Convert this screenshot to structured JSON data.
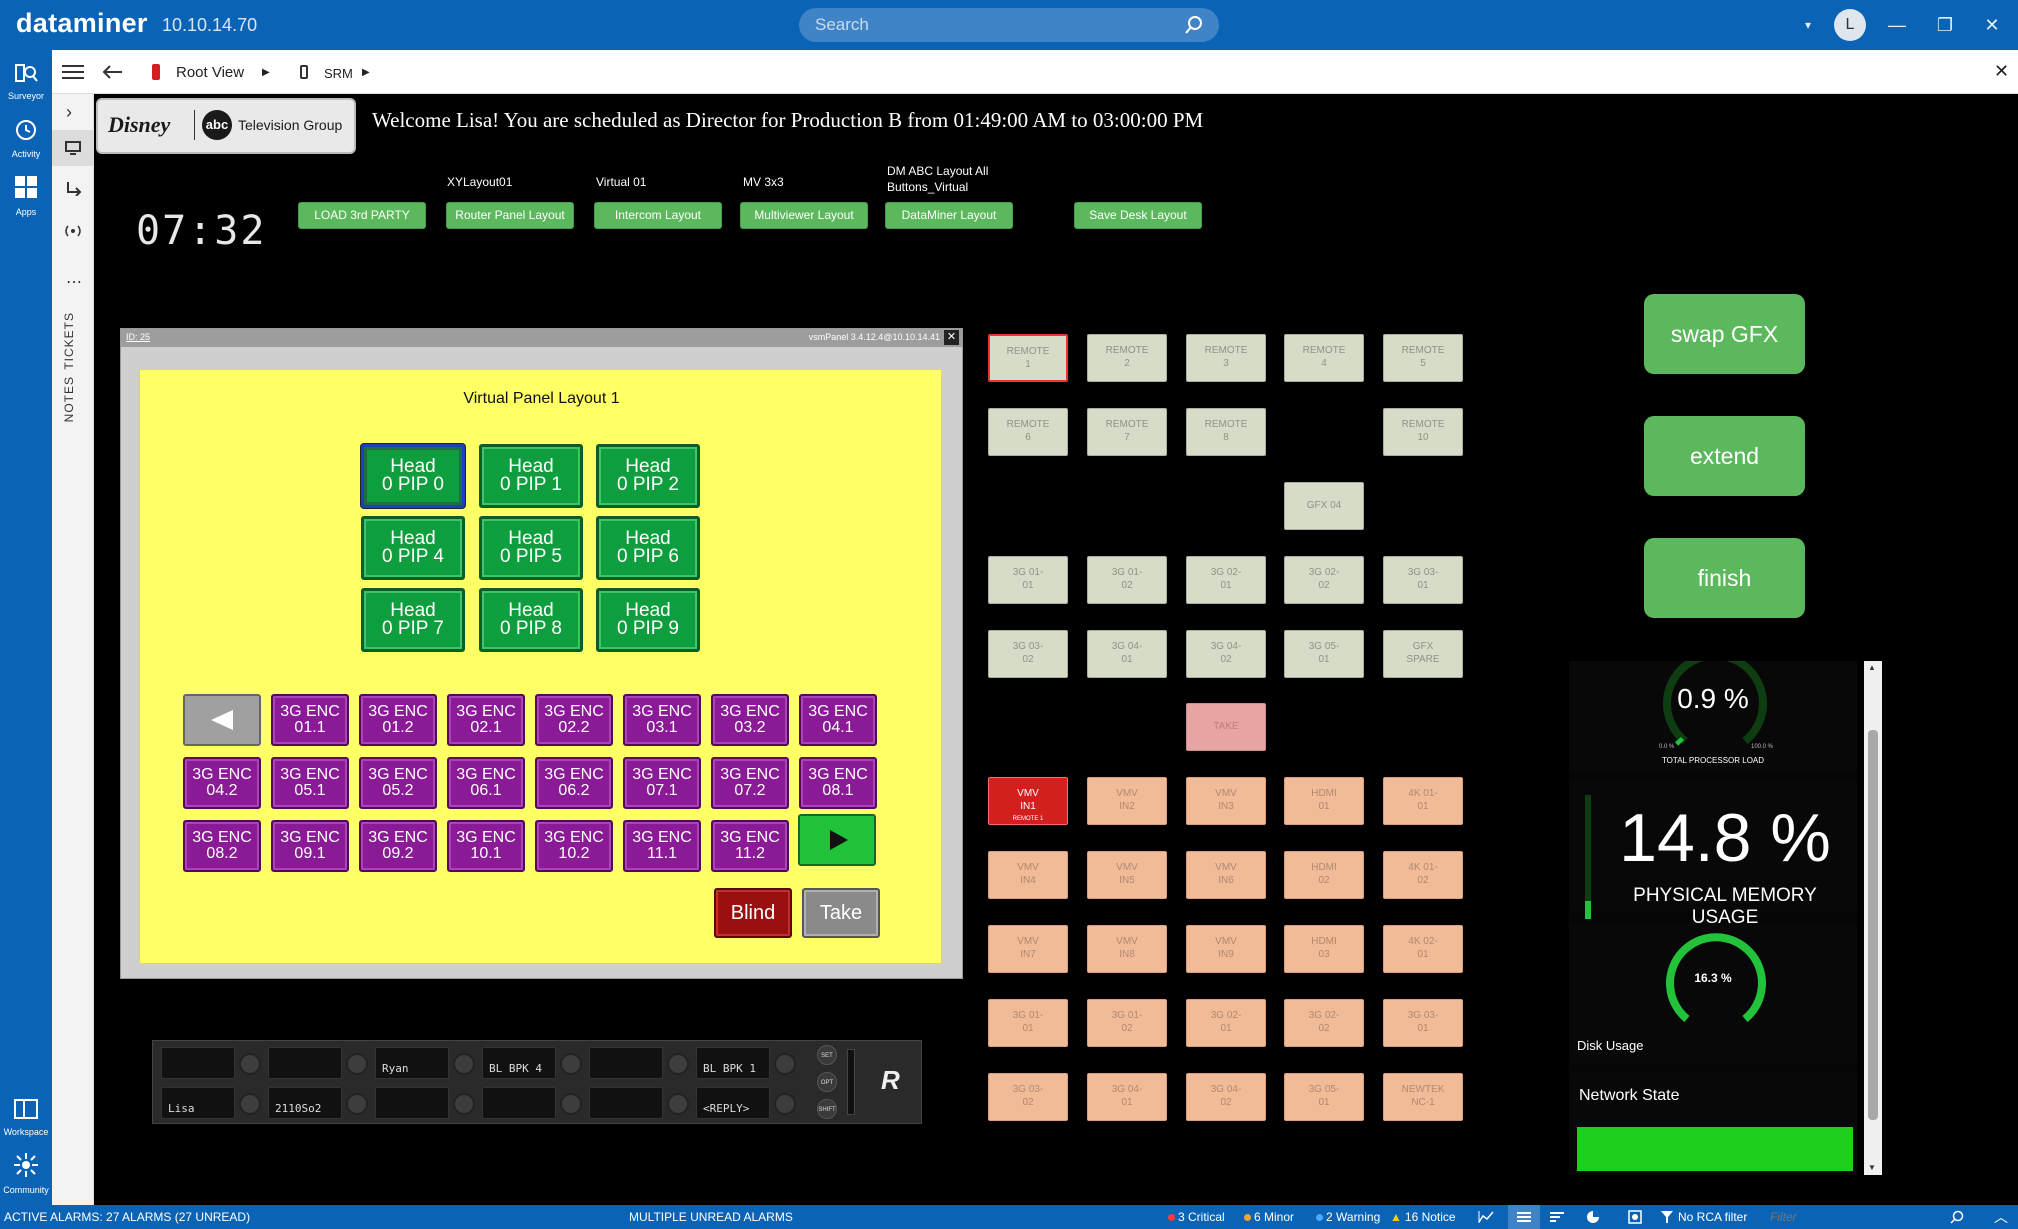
{
  "app": {
    "brand": "dataminer",
    "version": "10.10.14.70"
  },
  "search": {
    "placeholder": "Search"
  },
  "user": {
    "initial": "L"
  },
  "sidebar": {
    "items": [
      {
        "label": "Surveyor"
      },
      {
        "label": "Activity"
      },
      {
        "label": "Apps"
      },
      {
        "label": "Workspace"
      },
      {
        "label": "Community"
      }
    ]
  },
  "rail": {
    "tickets": "TICKETS",
    "notes": "NOTES"
  },
  "breadcrumb": {
    "root": "Root View",
    "srm": "SRM"
  },
  "header": {
    "welcome": "Welcome Lisa! You are scheduled as Director for Production B from 01:49:00 AM to 03:00:00 PM",
    "clock": "07:32",
    "logo_text": "Television Group"
  },
  "layout_buttons": [
    {
      "caption": "",
      "label": "LOAD 3rd PARTY"
    },
    {
      "caption": "XYLayout01",
      "label": "Router Panel Layout"
    },
    {
      "caption": "Virtual 01",
      "label": "Intercom Layout"
    },
    {
      "caption": "MV 3x3",
      "label": "Multiviewer Layout"
    },
    {
      "caption": "DM ABC Layout All Buttons_Virtual",
      "label": "DataMiner Layout"
    },
    {
      "caption": "",
      "label": "Save Desk Layout"
    }
  ],
  "vsm_panel": {
    "id_label": "ID: 25",
    "title_right": "vsmPanel 3.4.12.4@10.10.14.41",
    "layout_title": "Virtual Panel Layout 1",
    "head_buttons": [
      [
        "Head",
        "0 PIP 0"
      ],
      [
        "Head",
        "0 PIP 1"
      ],
      [
        "Head",
        "0 PIP 2"
      ],
      [
        "Head",
        "0 PIP 4"
      ],
      [
        "Head",
        "0 PIP 5"
      ],
      [
        "Head",
        "0 PIP 6"
      ],
      [
        "Head",
        "0 PIP 7"
      ],
      [
        "Head",
        "0 PIP 8"
      ],
      [
        "Head",
        "0 PIP 9"
      ]
    ],
    "enc_buttons": [
      "01.1",
      "01.2",
      "02.1",
      "02.2",
      "03.1",
      "03.2",
      "04.1",
      "04.2",
      "05.1",
      "05.2",
      "06.1",
      "06.2",
      "07.1",
      "07.2",
      "08.1",
      "08.2",
      "09.1",
      "09.2",
      "10.1",
      "10.2",
      "11.1",
      "11.2"
    ],
    "enc_prefix": "3G ENC",
    "blind": "Blind",
    "take": "Take"
  },
  "router_strip": {
    "top": [
      "",
      "",
      "Ryan",
      "BL BPK 4",
      "",
      "BL BPK 1"
    ],
    "bottom": [
      "Lisa",
      "2110So2",
      "",
      "",
      "",
      "<REPLY>"
    ],
    "side_labels": [
      "SET",
      "OPT",
      "SHIFT"
    ]
  },
  "grid": {
    "remote": [
      [
        "REMOTE",
        "1"
      ],
      [
        "REMOTE",
        "2"
      ],
      [
        "REMOTE",
        "3"
      ],
      [
        "REMOTE",
        "4"
      ],
      [
        "REMOTE",
        "5"
      ],
      [
        "REMOTE",
        "6"
      ],
      [
        "REMOTE",
        "7"
      ],
      [
        "REMOTE",
        "8"
      ],
      [
        "REMOTE",
        "10"
      ]
    ],
    "gfx04": "GFX 04",
    "sg_green": [
      [
        "3G 01-",
        "01"
      ],
      [
        "3G 01-",
        "02"
      ],
      [
        "3G 02-",
        "01"
      ],
      [
        "3G 02-",
        "02"
      ],
      [
        "3G 03-",
        "01"
      ],
      [
        "3G 03-",
        "02"
      ],
      [
        "3G 04-",
        "01"
      ],
      [
        "3G 04-",
        "02"
      ],
      [
        "3G 05-",
        "01"
      ],
      [
        "GFX",
        "SPARE"
      ]
    ],
    "take": "TAKE",
    "orange_row1": [
      [
        "VMV",
        "IN1"
      ],
      [
        "VMV",
        "IN2"
      ],
      [
        "VMV",
        "IN3"
      ],
      [
        "HDMI",
        "01"
      ],
      [
        "4K 01-",
        "01"
      ]
    ],
    "remote1_sub": "REMOTE 1",
    "orange_row2": [
      [
        "VMV",
        "IN4"
      ],
      [
        "VMV",
        "IN5"
      ],
      [
        "VMV",
        "IN6"
      ],
      [
        "HDMI",
        "02"
      ],
      [
        "4K 01-",
        "02"
      ]
    ],
    "orange_row3": [
      [
        "VMV",
        "IN7"
      ],
      [
        "VMV",
        "IN8"
      ],
      [
        "VMV",
        "IN9"
      ],
      [
        "HDMI",
        "03"
      ],
      [
        "4K 02-",
        "01"
      ]
    ],
    "orange_row4": [
      [
        "3G 01-",
        "01"
      ],
      [
        "3G 01-",
        "02"
      ],
      [
        "3G 02-",
        "01"
      ],
      [
        "3G 02-",
        "02"
      ],
      [
        "3G 03-",
        "01"
      ]
    ],
    "orange_row5": [
      [
        "3G 03-",
        "02"
      ],
      [
        "3G 04-",
        "01"
      ],
      [
        "3G 04-",
        "02"
      ],
      [
        "3G 05-",
        "01"
      ],
      [
        "NEWTEK",
        "NC-1"
      ]
    ]
  },
  "actions": {
    "swap": "swap GFX",
    "extend": "extend",
    "finish": "finish"
  },
  "stats": {
    "processor_value": "0.9 %",
    "processor_fraction": 0.009,
    "processor_min": "0.0 %",
    "processor_max": "100.0 %",
    "processor_label": "TOTAL PROCESSOR LOAD",
    "memory_value": "14.8 %",
    "memory_label": "PHYSICAL MEMORY USAGE",
    "disk_value": "16.3 %",
    "disk_fraction": 0.163,
    "disk_label": "Disk Usage",
    "network_label": "Network State"
  },
  "statusbar": {
    "alarms": "ACTIVE ALARMS: 27 ALARMS (27 UNREAD)",
    "multi": "MULTIPLE UNREAD ALARMS",
    "critical": "3 Critical",
    "minor": "6 Minor",
    "warning": "2 Warning",
    "notice": "16 Notice",
    "rca": "No RCA filter",
    "filter_placeholder": "Filter"
  },
  "colors": {
    "brand_blue": "#0b63b5",
    "green_button": "#5cb85c",
    "critical": "#ff3b3b",
    "minor": "#f5a623",
    "warning": "#4aa8ff",
    "notice": "#f5d000",
    "network_ok": "#1ecf1e"
  }
}
